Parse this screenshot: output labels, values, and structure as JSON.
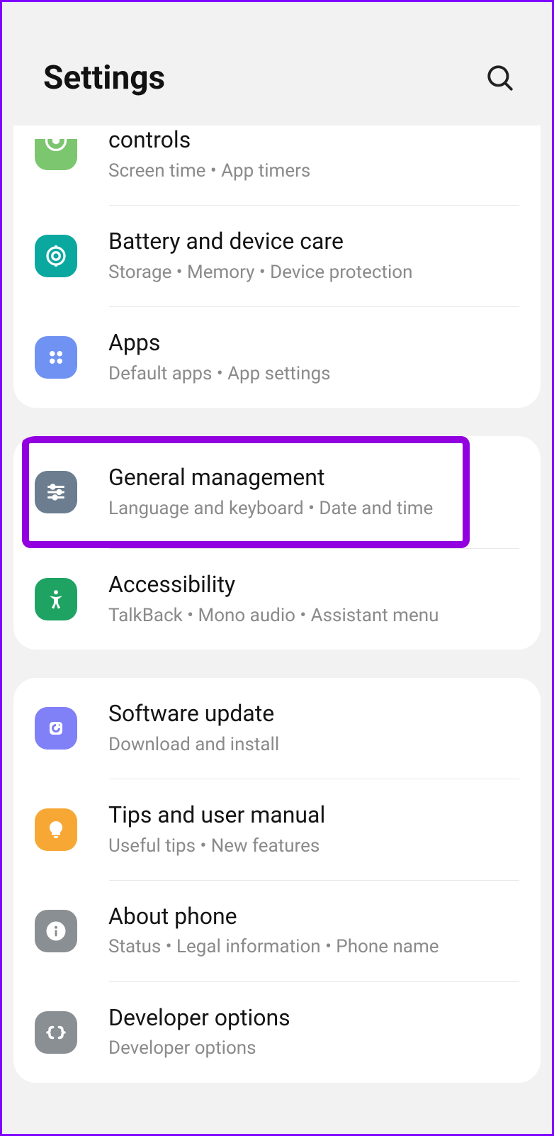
{
  "header": {
    "title": "Settings"
  },
  "groups": [
    {
      "items": [
        {
          "icon": "wellbeing-icon",
          "color": "c-green1",
          "title": "controls",
          "sub": "Screen time  •  App timers",
          "partial": true
        },
        {
          "icon": "target-icon",
          "color": "c-teal",
          "title": "Battery and device care",
          "sub": "Storage  •  Memory  •  Device protection"
        },
        {
          "icon": "apps-icon",
          "color": "c-blue",
          "title": "Apps",
          "sub": "Default apps  •  App settings"
        }
      ]
    },
    {
      "items": [
        {
          "icon": "sliders-icon",
          "color": "c-slate",
          "title": "General management",
          "sub": "Language and keyboard  •  Date and time",
          "highlight": true
        },
        {
          "icon": "person-icon",
          "color": "c-green2",
          "title": "Accessibility",
          "sub": "TalkBack  •  Mono audio  •  Assistant menu"
        }
      ]
    },
    {
      "items": [
        {
          "icon": "update-icon",
          "color": "c-violet",
          "title": "Software update",
          "sub": "Download and install"
        },
        {
          "icon": "bulb-icon",
          "color": "c-orange",
          "title": "Tips and user manual",
          "sub": "Useful tips  •  New features"
        },
        {
          "icon": "info-icon",
          "color": "c-gray",
          "title": "About phone",
          "sub": "Status  •  Legal information  •  Phone name"
        },
        {
          "icon": "code-icon",
          "color": "c-gray",
          "title": "Developer options",
          "sub": "Developer options"
        }
      ]
    }
  ]
}
